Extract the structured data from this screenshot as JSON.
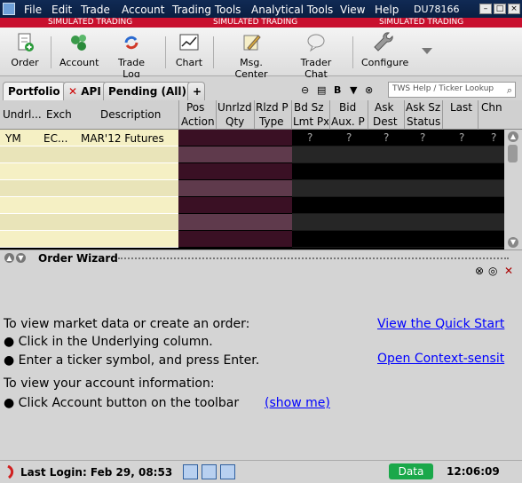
{
  "menubar": {
    "items": [
      "File",
      "Edit",
      "Trade",
      "Account",
      "Trading Tools",
      "Analytical Tools",
      "View",
      "Help"
    ],
    "account_id": "DU78166"
  },
  "banner": {
    "text": "SIMULATED TRADING"
  },
  "toolbar": {
    "buttons": [
      "Order",
      "Account",
      "Trade Log",
      "Chart",
      "Msg. Center",
      "Trader Chat",
      "Configure"
    ]
  },
  "tabs": {
    "items": [
      "Portfolio",
      "API",
      "Pending (All)"
    ],
    "add_label": "+",
    "search_placeholder": "TWS Help / Ticker Lookup"
  },
  "grid": {
    "headers_top": [
      "Undrl...",
      "Exch",
      "Description",
      "Pos",
      "Unrlzd",
      "Rlzd P",
      "Bd Sz",
      "Bid",
      "Ask",
      "Ask Sz",
      "Last",
      "Chn"
    ],
    "headers_bottom": [
      "Action",
      "Qty",
      "Type",
      "Lmt Px",
      "Aux. P",
      "Dest",
      "Status"
    ],
    "row": {
      "underlying": "YM",
      "exchange": "EC...",
      "description": "MAR'12 Futures",
      "placeholder": "?"
    }
  },
  "order_wizard": {
    "title": "Order Wizard",
    "line1": "To view market data or create an order:",
    "bullet1": "● Click in the Underlying column.",
    "bullet2": "● Enter a ticker symbol, and press Enter.",
    "line2": "To view your account information:",
    "bullet3": "● Click Account button on the toolbar",
    "show_me": "(show me)",
    "link_quickstart": "View the Quick Start",
    "link_context": "Open Context-sensit"
  },
  "statusbar": {
    "last_login": "Last Login: Feb 29, 08:53",
    "data_label": "Data",
    "clock": "12:06:09"
  },
  "colors": {
    "menubar": "#0a1f42",
    "banner": "#c8102e",
    "data_green": "#1aa84a",
    "link": "#0000ff"
  }
}
